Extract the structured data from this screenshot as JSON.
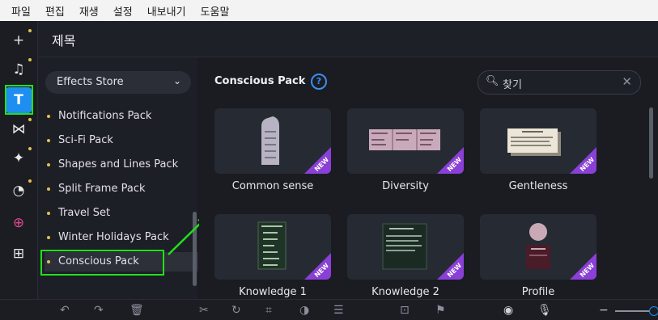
{
  "menu": [
    "파일",
    "편집",
    "재생",
    "설정",
    "내보내기",
    "도움말"
  ],
  "title": "제목",
  "store_label": "Effects Store",
  "categories": [
    "Notifications Pack",
    "Sci-Fi Pack",
    "Shapes and Lines Pack",
    "Split Frame Pack",
    "Travel Set",
    "Winter Holidays Pack",
    "Conscious Pack"
  ],
  "pack_title": "Conscious Pack",
  "help": "?",
  "search_placeholder": "찾기",
  "badge": "NEW",
  "cards": [
    {
      "label": "Common sense"
    },
    {
      "label": "Diversity"
    },
    {
      "label": "Gentleness"
    },
    {
      "label": "Knowledge 1"
    },
    {
      "label": "Knowledge 2"
    },
    {
      "label": "Profile"
    }
  ],
  "colors": {
    "accent": "#1f8ef1",
    "highlight": "#22e01b",
    "badge": "#8a3fd6"
  }
}
